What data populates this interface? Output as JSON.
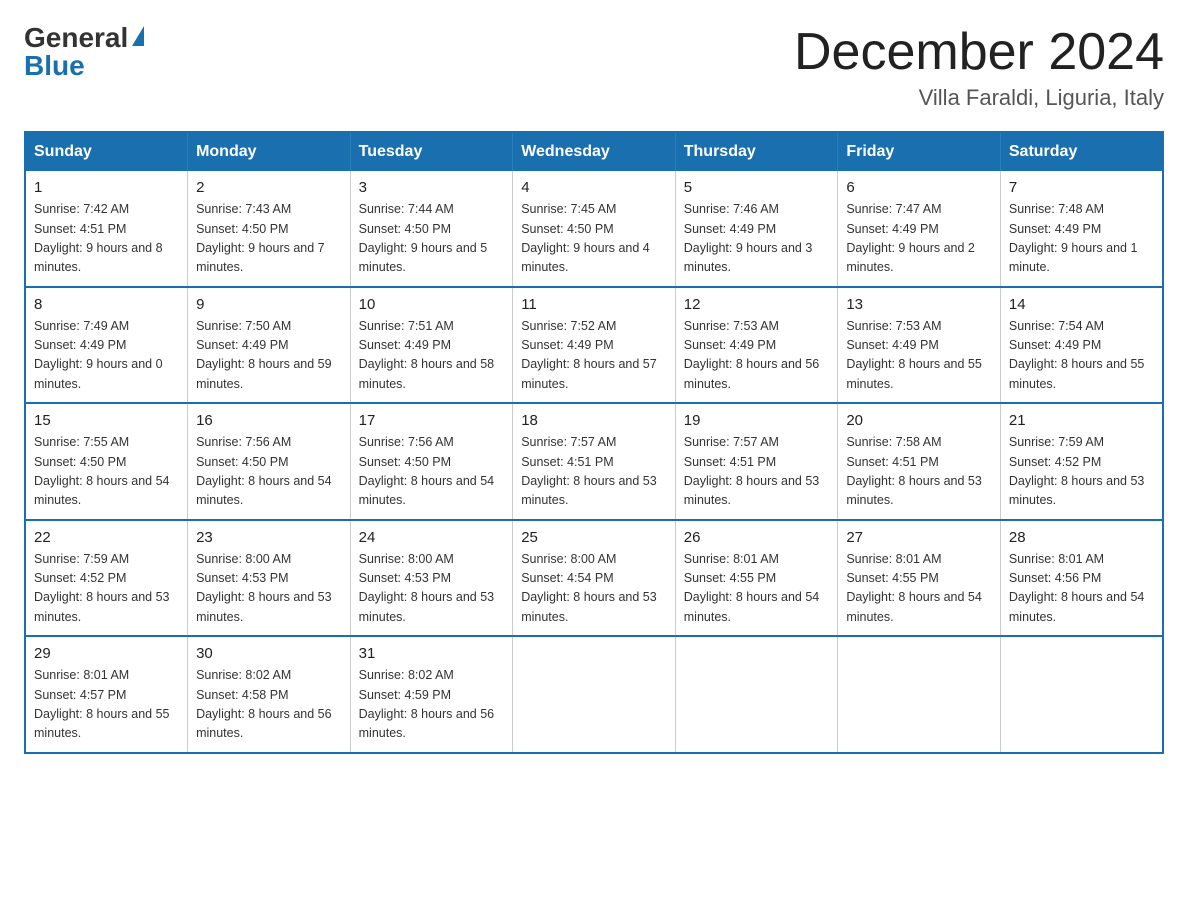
{
  "logo": {
    "general": "General",
    "blue": "Blue"
  },
  "title": "December 2024",
  "location": "Villa Faraldi, Liguria, Italy",
  "days_header": [
    "Sunday",
    "Monday",
    "Tuesday",
    "Wednesday",
    "Thursday",
    "Friday",
    "Saturday"
  ],
  "weeks": [
    [
      {
        "day": "1",
        "sunrise": "7:42 AM",
        "sunset": "4:51 PM",
        "daylight": "9 hours and 8 minutes."
      },
      {
        "day": "2",
        "sunrise": "7:43 AM",
        "sunset": "4:50 PM",
        "daylight": "9 hours and 7 minutes."
      },
      {
        "day": "3",
        "sunrise": "7:44 AM",
        "sunset": "4:50 PM",
        "daylight": "9 hours and 5 minutes."
      },
      {
        "day": "4",
        "sunrise": "7:45 AM",
        "sunset": "4:50 PM",
        "daylight": "9 hours and 4 minutes."
      },
      {
        "day": "5",
        "sunrise": "7:46 AM",
        "sunset": "4:49 PM",
        "daylight": "9 hours and 3 minutes."
      },
      {
        "day": "6",
        "sunrise": "7:47 AM",
        "sunset": "4:49 PM",
        "daylight": "9 hours and 2 minutes."
      },
      {
        "day": "7",
        "sunrise": "7:48 AM",
        "sunset": "4:49 PM",
        "daylight": "9 hours and 1 minute."
      }
    ],
    [
      {
        "day": "8",
        "sunrise": "7:49 AM",
        "sunset": "4:49 PM",
        "daylight": "9 hours and 0 minutes."
      },
      {
        "day": "9",
        "sunrise": "7:50 AM",
        "sunset": "4:49 PM",
        "daylight": "8 hours and 59 minutes."
      },
      {
        "day": "10",
        "sunrise": "7:51 AM",
        "sunset": "4:49 PM",
        "daylight": "8 hours and 58 minutes."
      },
      {
        "day": "11",
        "sunrise": "7:52 AM",
        "sunset": "4:49 PM",
        "daylight": "8 hours and 57 minutes."
      },
      {
        "day": "12",
        "sunrise": "7:53 AM",
        "sunset": "4:49 PM",
        "daylight": "8 hours and 56 minutes."
      },
      {
        "day": "13",
        "sunrise": "7:53 AM",
        "sunset": "4:49 PM",
        "daylight": "8 hours and 55 minutes."
      },
      {
        "day": "14",
        "sunrise": "7:54 AM",
        "sunset": "4:49 PM",
        "daylight": "8 hours and 55 minutes."
      }
    ],
    [
      {
        "day": "15",
        "sunrise": "7:55 AM",
        "sunset": "4:50 PM",
        "daylight": "8 hours and 54 minutes."
      },
      {
        "day": "16",
        "sunrise": "7:56 AM",
        "sunset": "4:50 PM",
        "daylight": "8 hours and 54 minutes."
      },
      {
        "day": "17",
        "sunrise": "7:56 AM",
        "sunset": "4:50 PM",
        "daylight": "8 hours and 54 minutes."
      },
      {
        "day": "18",
        "sunrise": "7:57 AM",
        "sunset": "4:51 PM",
        "daylight": "8 hours and 53 minutes."
      },
      {
        "day": "19",
        "sunrise": "7:57 AM",
        "sunset": "4:51 PM",
        "daylight": "8 hours and 53 minutes."
      },
      {
        "day": "20",
        "sunrise": "7:58 AM",
        "sunset": "4:51 PM",
        "daylight": "8 hours and 53 minutes."
      },
      {
        "day": "21",
        "sunrise": "7:59 AM",
        "sunset": "4:52 PM",
        "daylight": "8 hours and 53 minutes."
      }
    ],
    [
      {
        "day": "22",
        "sunrise": "7:59 AM",
        "sunset": "4:52 PM",
        "daylight": "8 hours and 53 minutes."
      },
      {
        "day": "23",
        "sunrise": "8:00 AM",
        "sunset": "4:53 PM",
        "daylight": "8 hours and 53 minutes."
      },
      {
        "day": "24",
        "sunrise": "8:00 AM",
        "sunset": "4:53 PM",
        "daylight": "8 hours and 53 minutes."
      },
      {
        "day": "25",
        "sunrise": "8:00 AM",
        "sunset": "4:54 PM",
        "daylight": "8 hours and 53 minutes."
      },
      {
        "day": "26",
        "sunrise": "8:01 AM",
        "sunset": "4:55 PM",
        "daylight": "8 hours and 54 minutes."
      },
      {
        "day": "27",
        "sunrise": "8:01 AM",
        "sunset": "4:55 PM",
        "daylight": "8 hours and 54 minutes."
      },
      {
        "day": "28",
        "sunrise": "8:01 AM",
        "sunset": "4:56 PM",
        "daylight": "8 hours and 54 minutes."
      }
    ],
    [
      {
        "day": "29",
        "sunrise": "8:01 AM",
        "sunset": "4:57 PM",
        "daylight": "8 hours and 55 minutes."
      },
      {
        "day": "30",
        "sunrise": "8:02 AM",
        "sunset": "4:58 PM",
        "daylight": "8 hours and 56 minutes."
      },
      {
        "day": "31",
        "sunrise": "8:02 AM",
        "sunset": "4:59 PM",
        "daylight": "8 hours and 56 minutes."
      },
      null,
      null,
      null,
      null
    ]
  ]
}
